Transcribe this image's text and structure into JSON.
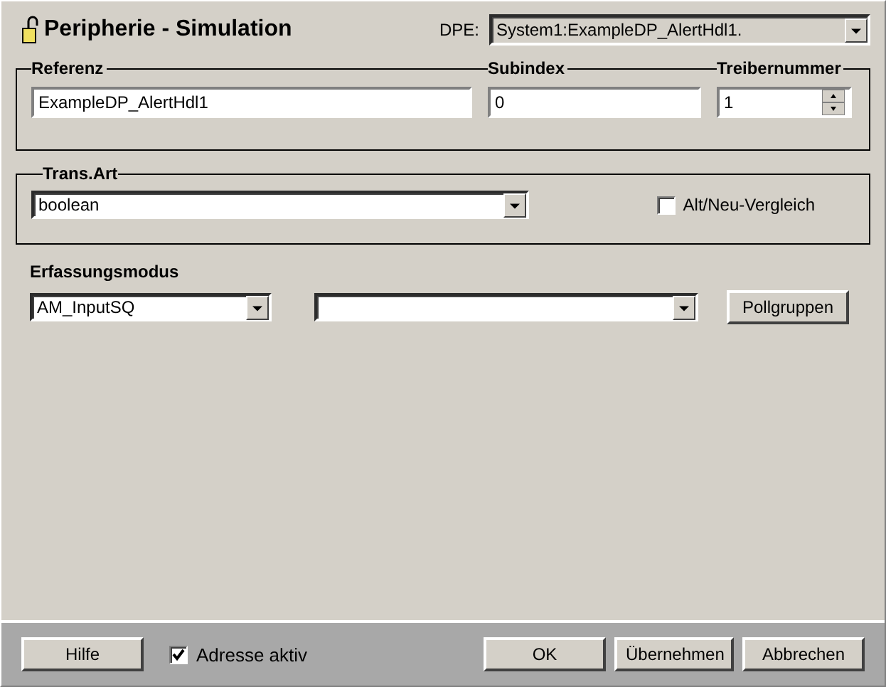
{
  "window": {
    "title": "Peripherie - Simulation"
  },
  "dpe": {
    "label": "DPE:",
    "value": "System1:ExampleDP_AlertHdl1."
  },
  "address_group": {
    "fields": [
      {
        "label": "Referenz",
        "value": "ExampleDP_AlertHdl1",
        "kind": "text"
      },
      {
        "label": "Subindex",
        "value": "0",
        "kind": "text"
      },
      {
        "label": "Treibernummer",
        "value": "1",
        "kind": "spin"
      }
    ]
  },
  "trans_art": {
    "label": "Trans.Art",
    "value": "boolean",
    "compare": {
      "label": "Alt/Neu-Vergleich",
      "checked": false
    }
  },
  "erfassungsmodus": {
    "label": "Erfassungsmodus",
    "mode": "AM_InputSQ",
    "button": "Pollgruppen"
  },
  "footer": {
    "help": "Hilfe",
    "active": {
      "label": "Adresse aktiv",
      "checked": true
    },
    "buttons": [
      "OK",
      "Übernehmen",
      "Abbrechen"
    ]
  }
}
